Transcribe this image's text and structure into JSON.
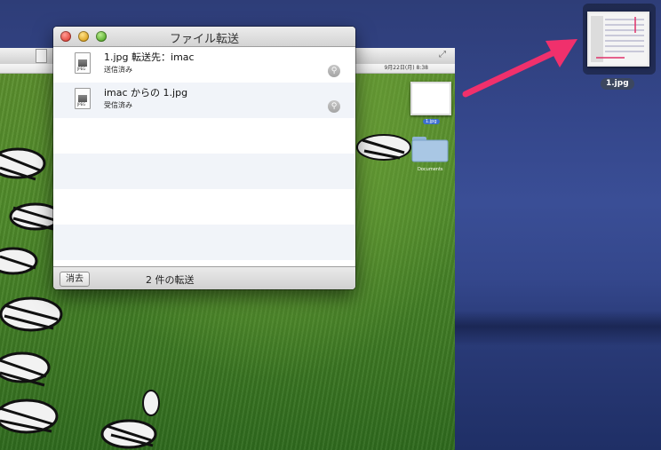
{
  "window": {
    "title": "ファイル転送",
    "transfers": [
      {
        "file_name": "1.jpg 転送先：imac",
        "status": "送信済み",
        "icon_ext": "JPEG"
      },
      {
        "file_name": "imac からの 1.jpg",
        "status": "受信済み",
        "icon_ext": "JPEG"
      }
    ],
    "footer": {
      "clear_button": "消去",
      "transfer_count": "2 件の転送"
    }
  },
  "remote_screen": {
    "menubar_clock": "9月22日(月) 8:38",
    "thumb_label": "1.jpg",
    "folder_label": "Documents"
  },
  "desktop": {
    "file_label": "1.jpg",
    "arrow_color": "#f0306c"
  }
}
